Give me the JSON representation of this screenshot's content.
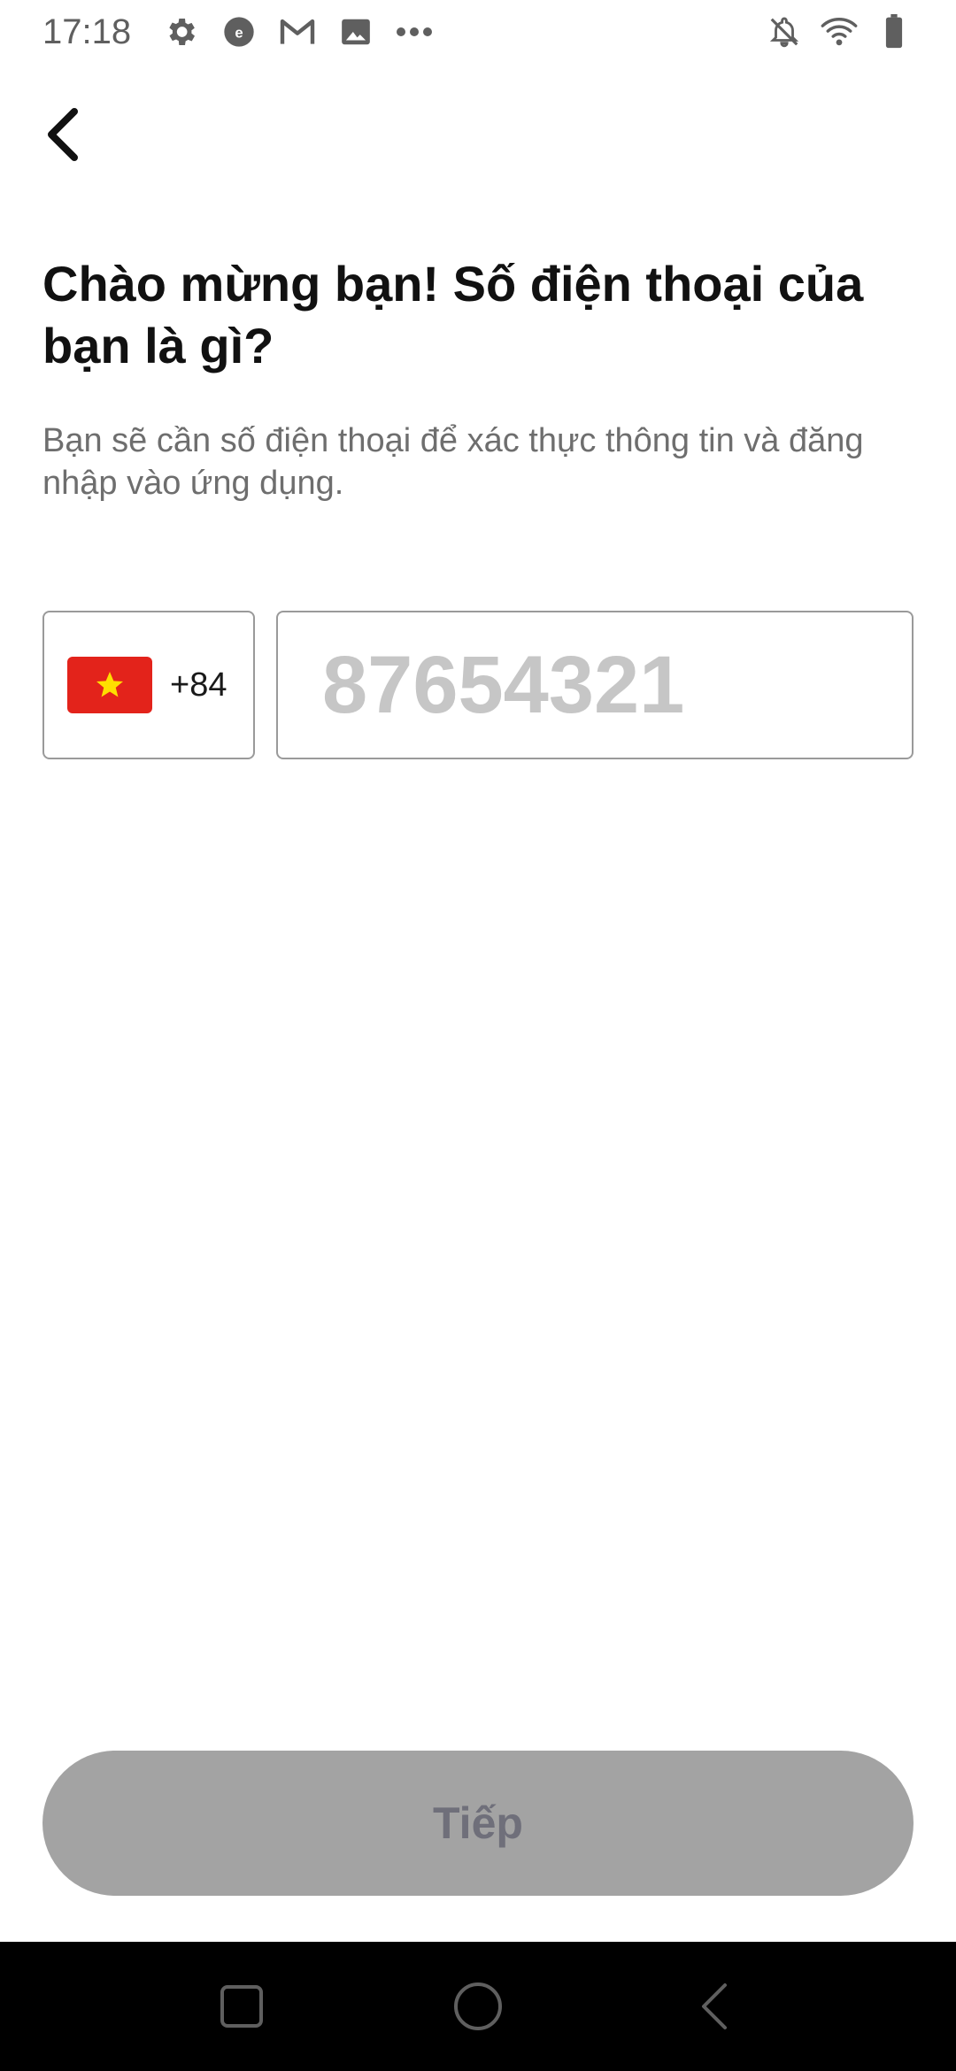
{
  "status_bar": {
    "time": "17:18",
    "left_icons": [
      "settings-icon",
      "vpn-icon",
      "gmail-icon",
      "image-icon",
      "more-dots-icon"
    ],
    "right_icons": [
      "notifications-off-icon",
      "wifi-icon",
      "battery-icon"
    ]
  },
  "header": {
    "back_icon": "back-arrow-icon"
  },
  "main": {
    "title": "Chào mừng bạn! Số điện thoại của bạn là gì?",
    "subtitle": "Bạn sẽ cần số điện thoại để xác thực thông tin và đăng nhập vào ứng dụng.",
    "country": {
      "flag": "vietnam-flag-icon",
      "dial_code": "+84"
    },
    "phone": {
      "value": "",
      "placeholder": "87654321"
    }
  },
  "footer": {
    "next_label": "Tiếp"
  },
  "nav_bar": {
    "buttons": [
      "recent-apps-button",
      "home-button",
      "back-button"
    ]
  },
  "colors": {
    "flag_red": "#e3231b",
    "flag_star": "#ffde00",
    "button_disabled_bg": "#a3a3a3",
    "button_disabled_text": "#6f6f7a",
    "placeholder": "#c6c6c6"
  }
}
